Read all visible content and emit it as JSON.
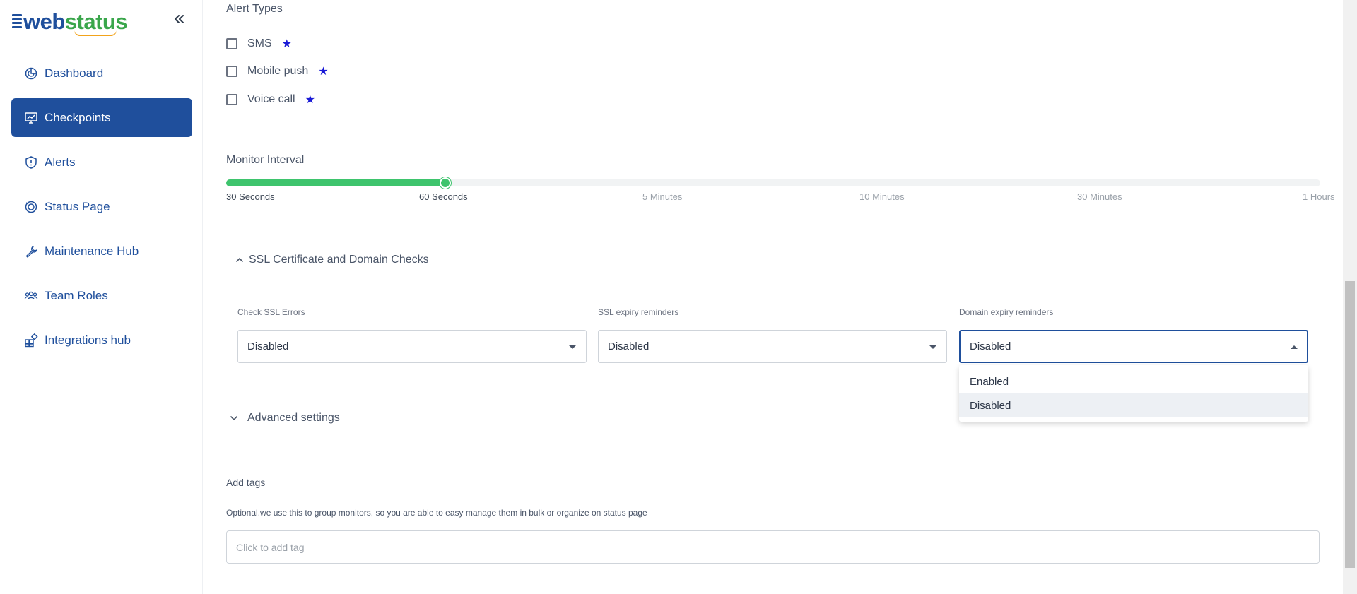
{
  "logo": {
    "part1": "web",
    "part2": "status"
  },
  "sidebar": {
    "collapse_icon": "double-chevron-left-icon",
    "items": [
      {
        "label": "Dashboard",
        "icon": "pie-chart-icon",
        "active": false
      },
      {
        "label": "Checkpoints",
        "icon": "monitor-chart-icon",
        "active": true
      },
      {
        "label": "Alerts",
        "icon": "shield-alert-icon",
        "active": false
      },
      {
        "label": "Status Page",
        "icon": "status-signal-icon",
        "active": false
      },
      {
        "label": "Maintenance Hub",
        "icon": "wrench-icon",
        "active": false
      },
      {
        "label": "Team Roles",
        "icon": "team-icon",
        "active": false
      },
      {
        "label": "Integrations hub",
        "icon": "integrations-icon",
        "active": false
      }
    ]
  },
  "alert_types": {
    "title": "Alert Types",
    "options": [
      {
        "label": "SMS",
        "checked": false,
        "premium": true
      },
      {
        "label": "Mobile push",
        "checked": false,
        "premium": true
      },
      {
        "label": "Voice call",
        "checked": false,
        "premium": true
      }
    ],
    "premium_icon": "star-icon"
  },
  "monitor_interval": {
    "title": "Monitor Interval",
    "ticks": [
      "30 Seconds",
      "60 Seconds",
      "5 Minutes",
      "10 Minutes",
      "30 Minutes",
      "1 Hours"
    ],
    "selected": "60 Seconds",
    "value_fraction": 0.2,
    "accent": "#3ec46d"
  },
  "ssl_section": {
    "title": "SSL Certificate and Domain Checks",
    "expanded": true,
    "fields": [
      {
        "label": "Check SSL Errors",
        "value": "Disabled"
      },
      {
        "label": "SSL expiry reminders",
        "value": "Disabled"
      },
      {
        "label": "Domain expiry reminders",
        "value": "Disabled",
        "open": true
      }
    ],
    "dropdown_options": [
      "Enabled",
      "Disabled"
    ],
    "dropdown_selected": "Disabled"
  },
  "advanced": {
    "title": "Advanced settings",
    "expanded": false
  },
  "tags": {
    "title": "Add tags",
    "help": "Optional.we use this to group monitors, so you are able to easy manage them in bulk or organize on status page",
    "placeholder": "Click to add tag"
  },
  "colors": {
    "brand": "#1f4f9c",
    "green": "#3ec46d",
    "star": "#1a1ad6"
  }
}
